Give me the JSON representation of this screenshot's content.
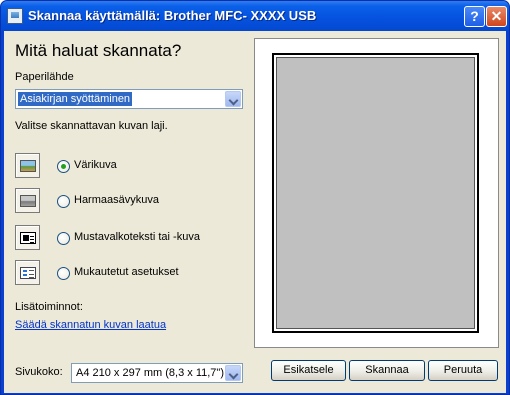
{
  "window": {
    "title": "Skannaa käyttämällä: Brother MFC- XXXX   USB",
    "help_label": "?",
    "close_label": "✕"
  },
  "main": {
    "heading": "Mitä haluat skannata?",
    "paper_source_label": "Paperilähde",
    "paper_source_value": "Asiakirjan syöttäminen",
    "scan_type_label": "Valitse skannattavan kuvan laji.",
    "scan_types": [
      {
        "label": "Värikuva",
        "icon": "color-photo-icon",
        "selected": true
      },
      {
        "label": "Harmaasävykuva",
        "icon": "grayscale-photo-icon",
        "selected": false
      },
      {
        "label": "Mustavalkoteksti tai -kuva",
        "icon": "black-white-text-icon",
        "selected": false
      },
      {
        "label": "Mukautetut asetukset",
        "icon": "custom-settings-icon",
        "selected": false
      }
    ],
    "more_options_label": "Lisätoiminnot:",
    "adjust_link": "Säädä skannatun kuvan laatua",
    "page_size_label": "Sivukoko:",
    "page_size_value": "A4 210 x 297 mm (8,3 x 11,7\")"
  },
  "buttons": {
    "preview": "Esikatsele",
    "scan": "Skannaa",
    "cancel": "Peruuta"
  },
  "colors": {
    "titlebar": "#0553e0",
    "dialog_bg": "#ece9d8",
    "link": "#0033cc",
    "selection": "#316ac5"
  }
}
